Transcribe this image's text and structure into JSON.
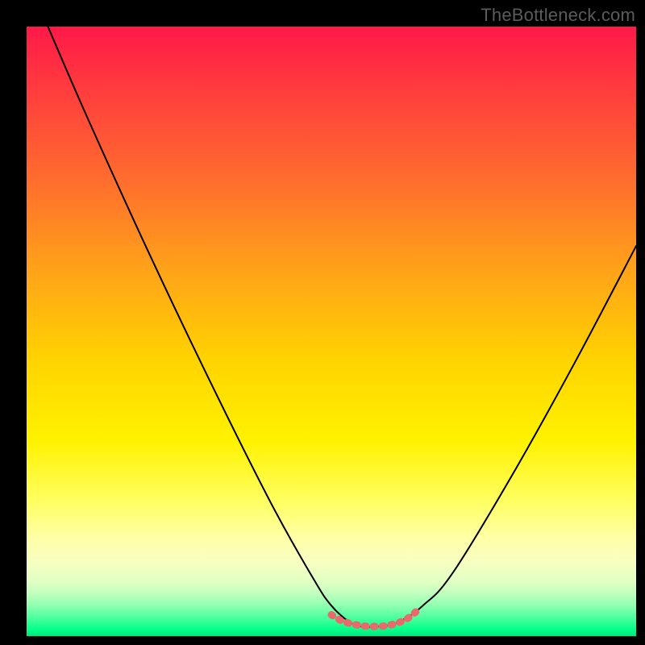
{
  "watermark": "TheBottleneck.com",
  "chart_data": {
    "type": "line",
    "title": "",
    "xlabel": "",
    "ylabel": "",
    "xlim": [
      0,
      100
    ],
    "ylim": [
      0,
      100
    ],
    "grid": false,
    "series": [
      {
        "name": "primary-curve",
        "color": "#000000",
        "x": [
          3.5,
          10,
          20,
          30,
          40,
          47,
          50,
          53,
          55,
          58,
          61,
          65,
          70,
          80,
          90,
          100
        ],
        "y": [
          100,
          85,
          63,
          42,
          22,
          9.5,
          5,
          2.3,
          1.6,
          1.6,
          2.3,
          5,
          10.5,
          27,
          45,
          64
        ]
      },
      {
        "name": "flat-segment",
        "color": "#e86a6a",
        "x": [
          50,
          51.5,
          53,
          55,
          56.5,
          58,
          59.5,
          61,
          62.5,
          64
        ],
        "y": [
          3.5,
          2.6,
          2.1,
          1.7,
          1.6,
          1.6,
          1.8,
          2.2,
          2.9,
          4.1
        ]
      }
    ],
    "gradient_background": {
      "direction": "vertical",
      "stops": [
        {
          "pos": 0.0,
          "color": "#ff1949"
        },
        {
          "pos": 0.1,
          "color": "#ff3b3e"
        },
        {
          "pos": 0.25,
          "color": "#ff6c2e"
        },
        {
          "pos": 0.4,
          "color": "#ffa319"
        },
        {
          "pos": 0.55,
          "color": "#ffd400"
        },
        {
          "pos": 0.68,
          "color": "#fff200"
        },
        {
          "pos": 0.78,
          "color": "#ffff63"
        },
        {
          "pos": 0.84,
          "color": "#ffffa8"
        },
        {
          "pos": 0.88,
          "color": "#f7ffc2"
        },
        {
          "pos": 0.91,
          "color": "#e1ffc2"
        },
        {
          "pos": 0.93,
          "color": "#c0ffbf"
        },
        {
          "pos": 0.95,
          "color": "#8fffb0"
        },
        {
          "pos": 0.97,
          "color": "#4bff9e"
        },
        {
          "pos": 0.99,
          "color": "#00ff88"
        },
        {
          "pos": 1.0,
          "color": "#00e57e"
        }
      ]
    }
  }
}
